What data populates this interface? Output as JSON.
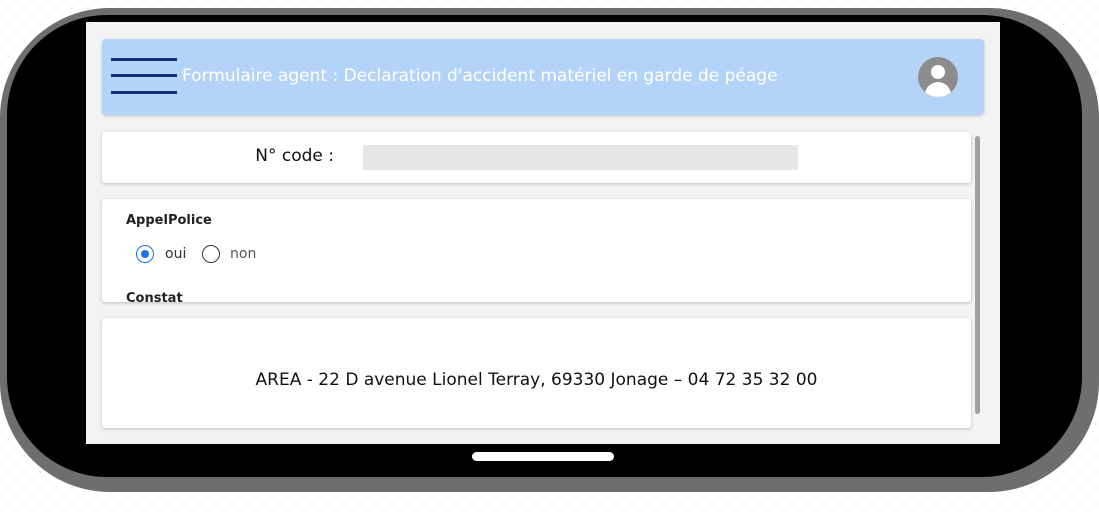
{
  "header": {
    "title": "Formulaire agent : Declaration d'accident matériel en garde de péage",
    "menu_icon": "hamburger-menu-icon",
    "avatar_icon": "user-avatar-icon"
  },
  "code_field": {
    "label": "N° code :",
    "value": "",
    "placeholder": ""
  },
  "appel_police": {
    "label": "AppelPolice",
    "options": [
      {
        "label": "oui",
        "selected": true
      },
      {
        "label": "non",
        "selected": false
      }
    ]
  },
  "constat": {
    "label": "Constat"
  },
  "footer": {
    "text": "AREA - 22 D avenue Lionel Terray, 69330 Jonage – 04 72 35 32 00"
  },
  "colors": {
    "header_bg": "#b3d4f7",
    "menu_icon": "#142d7a",
    "radio_accent": "#1a73e8",
    "device_frame": "#6e6e6e"
  }
}
